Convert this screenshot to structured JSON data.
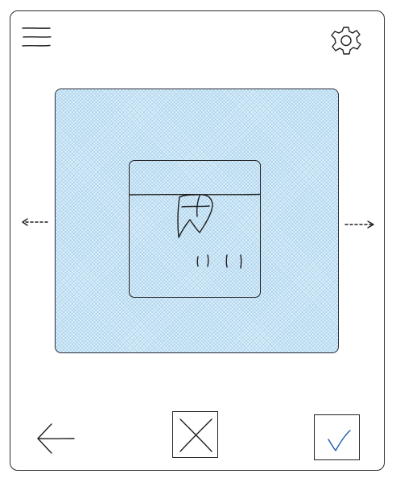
{
  "icons": {
    "menu": "hamburger-menu-icon",
    "settings": "gear-icon",
    "prev": "arrow-left-dashed-icon",
    "next": "arrow-right-dashed-icon",
    "back": "back-arrow-icon",
    "cancel": "close-x-icon",
    "confirm": "checkmark-icon"
  },
  "colors": {
    "panel_fill": "#dff0fa",
    "panel_hatch": "#6eafdc",
    "check_stroke": "#1e5aa8",
    "ink": "#1f1f1f"
  },
  "preview": {
    "content": "sketch-placeholder"
  }
}
